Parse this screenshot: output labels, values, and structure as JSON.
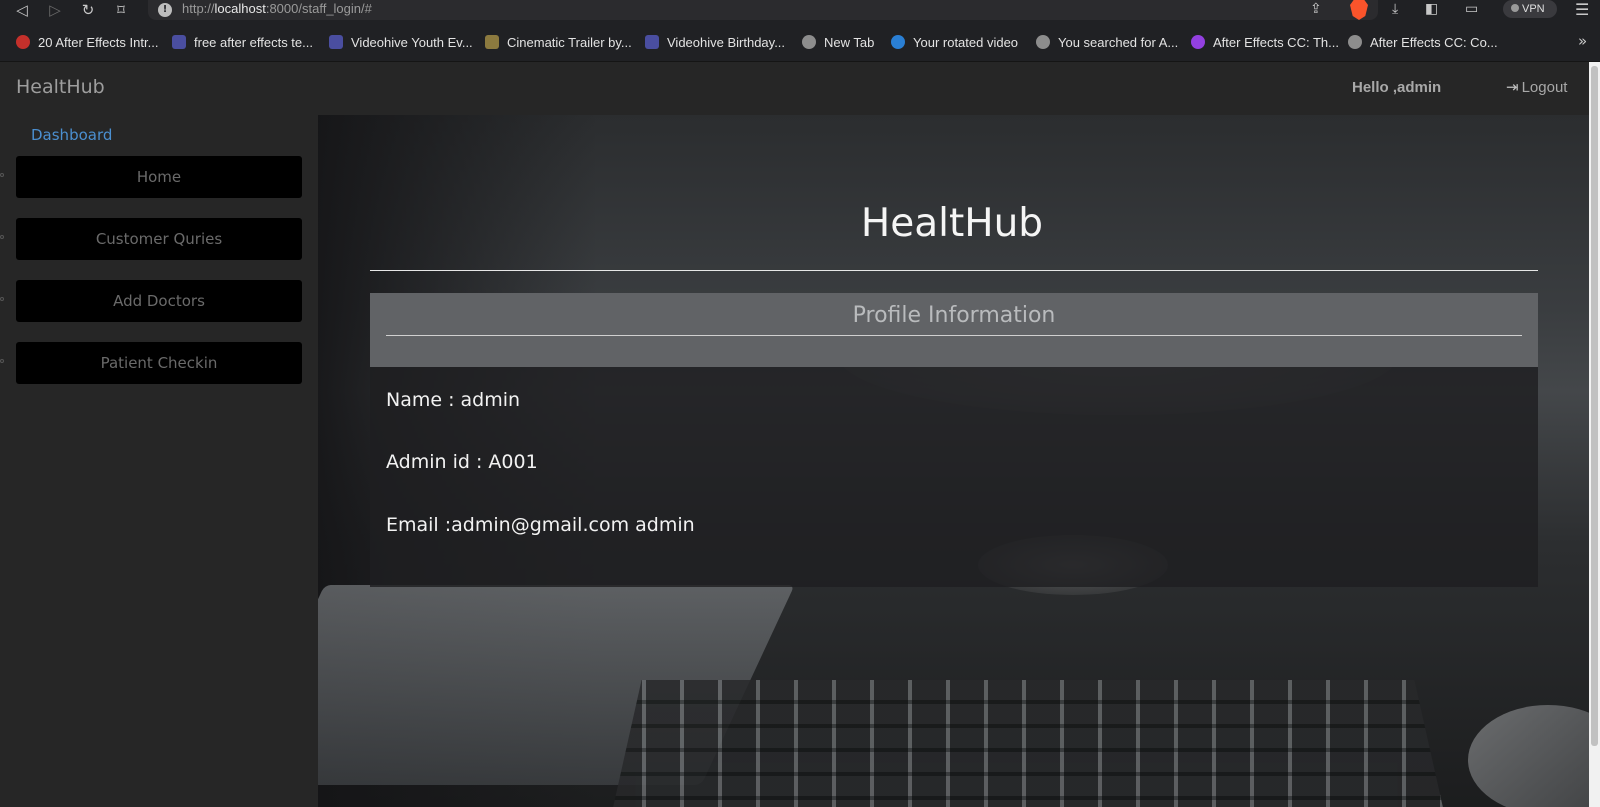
{
  "browser": {
    "url_scheme": "http://",
    "url_host": "localhost",
    "url_path": ":8000/staff_login/#",
    "vpn_label": "VPN",
    "bookmarks": [
      {
        "label": "20 After Effects Intr...",
        "icon": "youtube-icon"
      },
      {
        "label": "free after effects te...",
        "icon": "ae-icon"
      },
      {
        "label": "Videohive Youth Ev...",
        "icon": "ae-icon"
      },
      {
        "label": "Cinematic Trailer by...",
        "icon": "cinematic-icon"
      },
      {
        "label": "Videohive Birthday...",
        "icon": "ae-icon"
      },
      {
        "label": "New Tab",
        "icon": "globe-icon"
      },
      {
        "label": "Your rotated video",
        "icon": "rotate-icon"
      },
      {
        "label": "You searched for A...",
        "icon": "globe-icon"
      },
      {
        "label": "After Effects CC: Th...",
        "icon": "u-icon"
      },
      {
        "label": "After Effects CC: Co...",
        "icon": "globe-icon"
      }
    ],
    "more_label": "»"
  },
  "header": {
    "brand": "HealtHub",
    "greeting": "Hello ,admin",
    "logout_label": "Logout"
  },
  "sidebar": {
    "title": "Dashboard",
    "items": [
      {
        "label": "Home"
      },
      {
        "label": "Customer Quries"
      },
      {
        "label": "Add Doctors"
      },
      {
        "label": "Patient Checkin"
      }
    ]
  },
  "main": {
    "title": "HealtHub",
    "card": {
      "heading": "Profile Information",
      "name_line": "Name : admin",
      "id_line": "Admin id : A001",
      "email_line": "Email :admin@gmail.com admin"
    }
  },
  "colors": {
    "accent_link": "#4b8fd0",
    "brave_orange": "#fb542b",
    "sidebar_bg": "#262626",
    "button_bg": "#000000"
  }
}
